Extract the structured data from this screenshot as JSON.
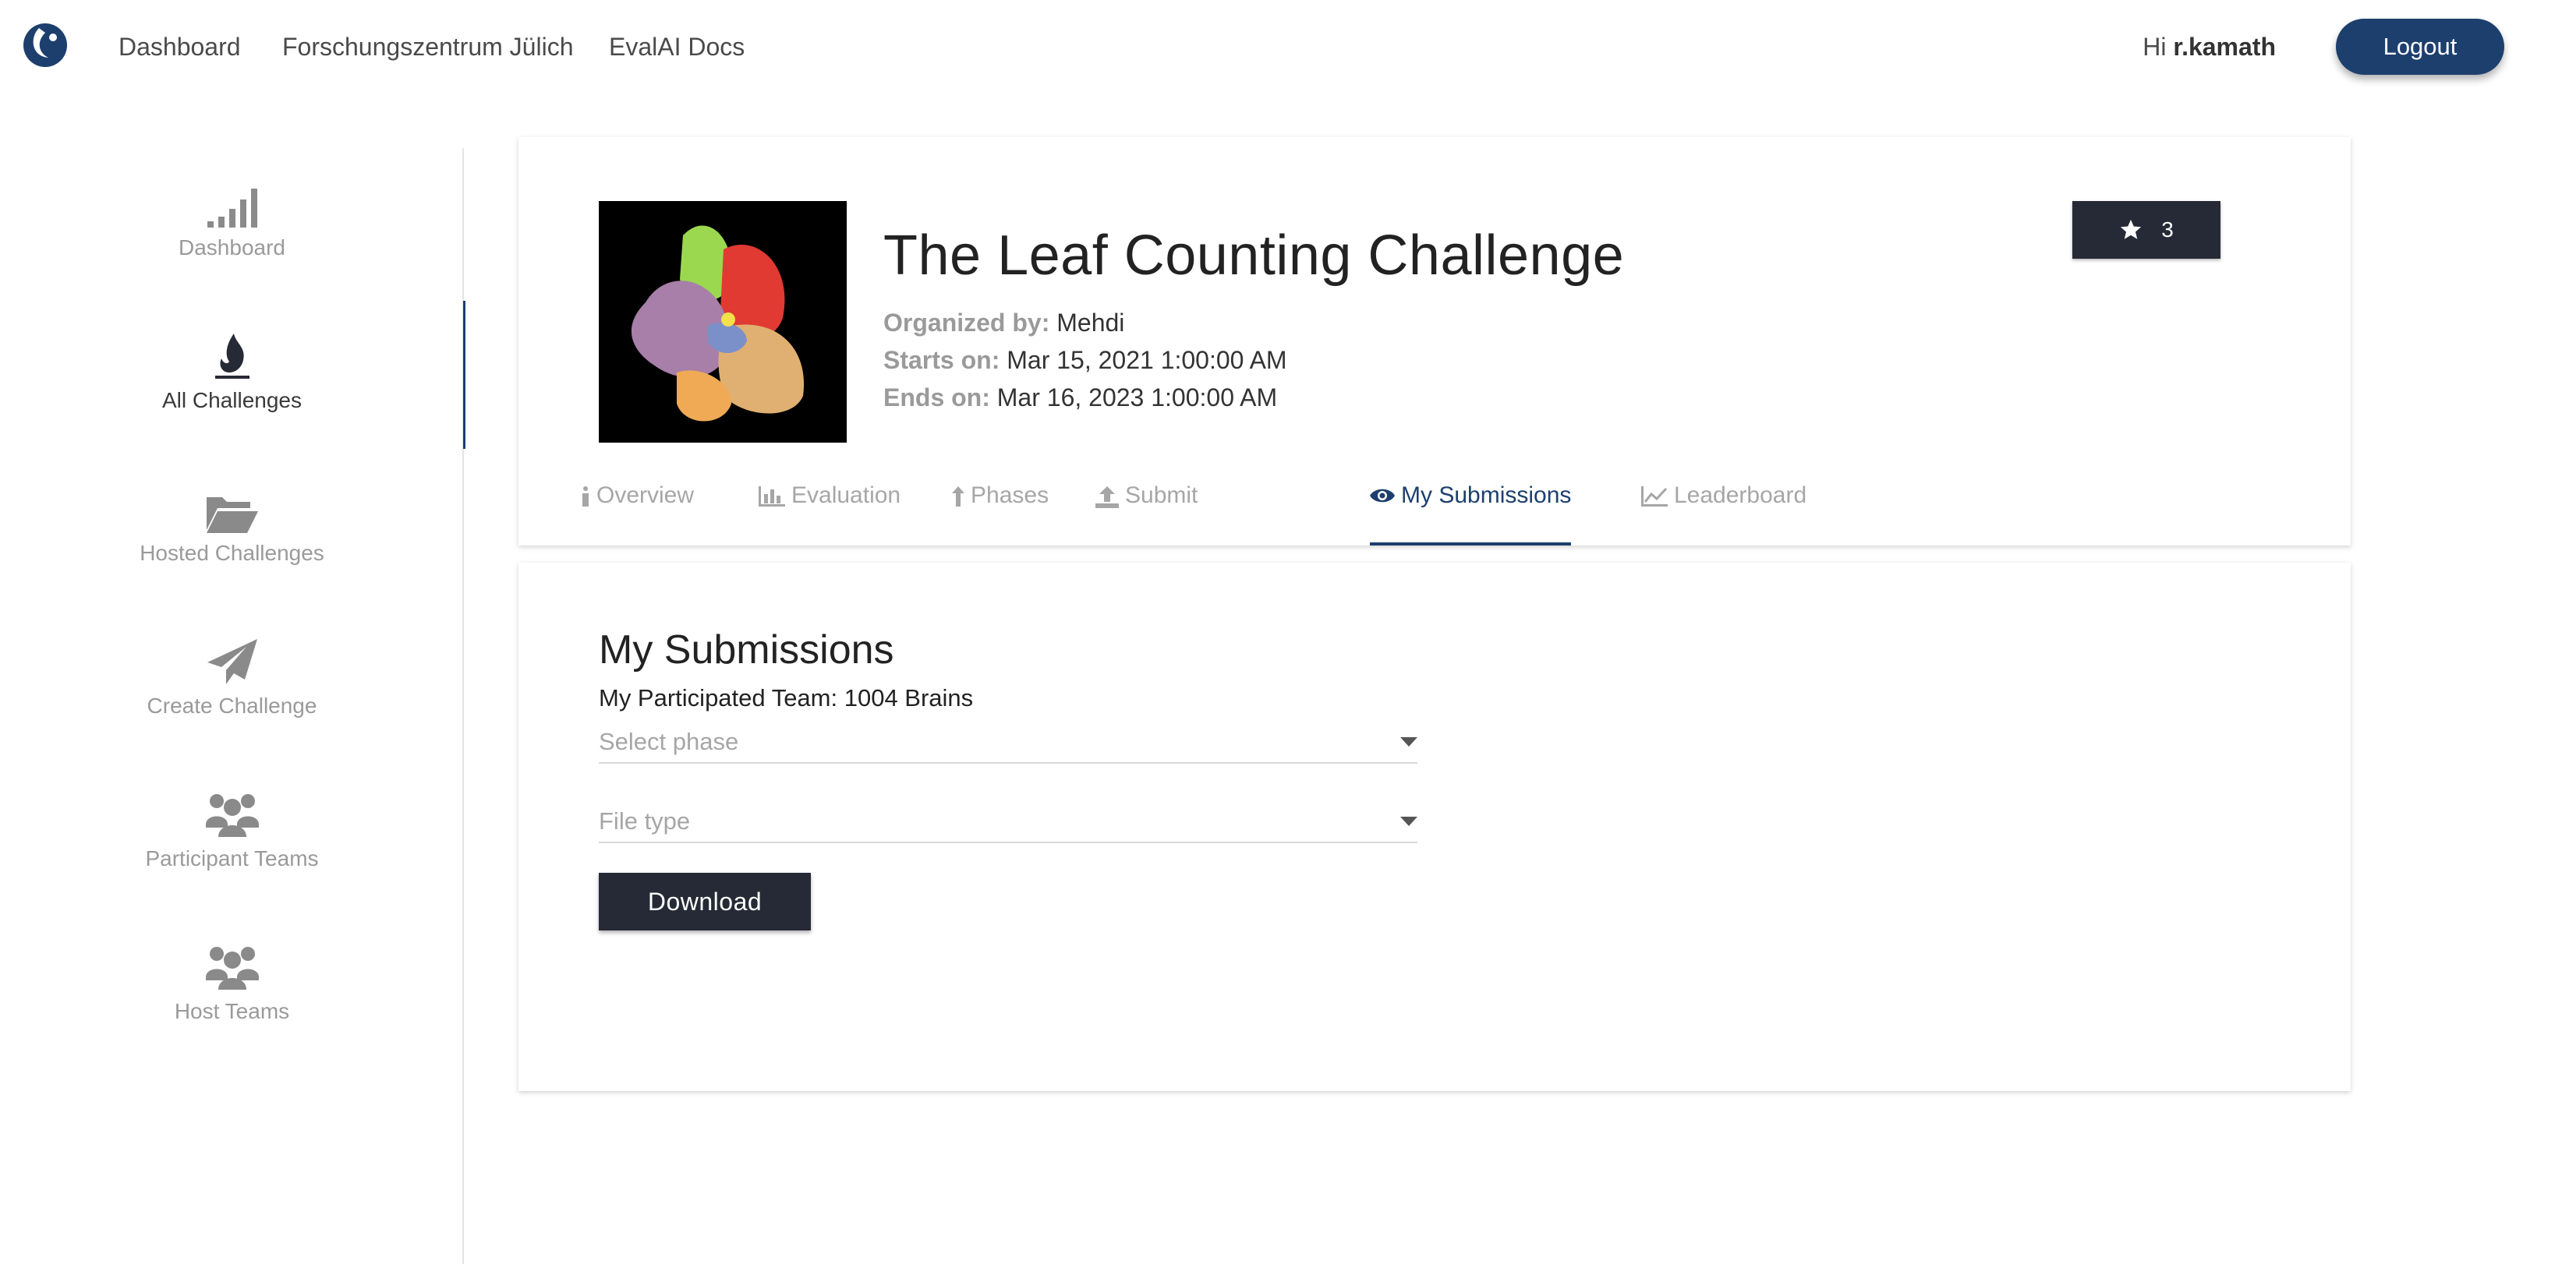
{
  "topnav": {
    "links": [
      "Dashboard",
      "Forschungszentrum Jülich",
      "EvalAI Docs"
    ],
    "greeting": "Hi",
    "username": "r.kamath",
    "logout_label": "Logout",
    "brand_color": "#1d3f6e"
  },
  "sidebar": {
    "items": [
      {
        "label": "Dashboard",
        "icon": "signal-bars-icon"
      },
      {
        "label": "All Challenges",
        "icon": "fire-icon",
        "active": true
      },
      {
        "label": "Hosted Challenges",
        "icon": "folder-open-icon"
      },
      {
        "label": "Create Challenge",
        "icon": "paper-plane-icon"
      },
      {
        "label": "Participant Teams",
        "icon": "users-icon"
      },
      {
        "label": "Host Teams",
        "icon": "users-icon"
      }
    ]
  },
  "challenge": {
    "title": "The Leaf Counting Challenge",
    "organized_by_label": "Organized by:",
    "organized_by": "Mehdi",
    "starts_label": "Starts on:",
    "starts_on": "Mar 15, 2021 1:00:00 AM",
    "ends_label": "Ends on:",
    "ends_on": "Mar 16, 2023 1:00:00 AM",
    "star_count": "3",
    "tabs": [
      {
        "label": "Overview",
        "icon": "info-icon"
      },
      {
        "label": "Evaluation",
        "icon": "bar-chart-icon"
      },
      {
        "label": "Phases",
        "icon": "arrow-up-icon"
      },
      {
        "label": "Submit",
        "icon": "upload-icon"
      },
      {
        "label": "My Submissions",
        "icon": "eye-icon",
        "active": true
      },
      {
        "label": "Leaderboard",
        "icon": "line-chart-icon"
      }
    ]
  },
  "submissions": {
    "title": "My Submissions",
    "team_line": "My Participated Team: 1004 Brains",
    "phase_placeholder": "Select phase",
    "filetype_placeholder": "File type",
    "download_label": "Download"
  }
}
